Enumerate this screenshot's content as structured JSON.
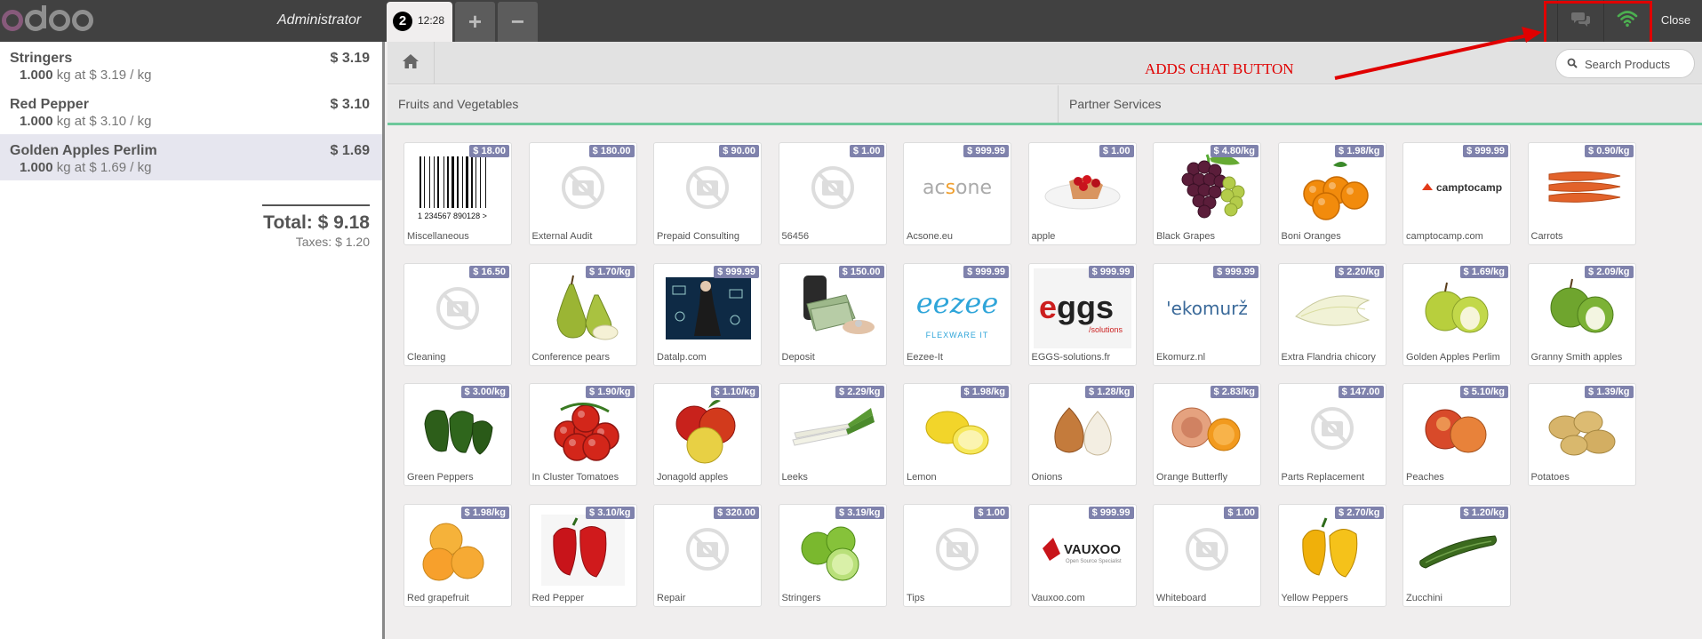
{
  "header": {
    "cashier": "Administrator",
    "order_number": "2",
    "order_time": "12:28",
    "add_order": "+",
    "delete_order": "−",
    "close_label": "Close",
    "icons": [
      "odoo-logo",
      "chat-icon",
      "wifi-icon"
    ],
    "colors": {
      "bar": "#414141",
      "wifi": "#4caf50",
      "highlight": "#e00000"
    }
  },
  "order": {
    "lines": [
      {
        "name": "Stringers",
        "price": "$ 3.19",
        "qty": "1.000",
        "info": "kg at $ 3.19 / kg"
      },
      {
        "name": "Red Pepper",
        "price": "$ 3.10",
        "qty": "1.000",
        "info": "kg at $ 3.10 / kg"
      },
      {
        "name": "Golden Apples Perlim",
        "price": "$ 1.69",
        "qty": "1.000",
        "info": "kg at $ 1.69 / kg"
      }
    ],
    "total": "Total: $ 9.18",
    "taxes": "Taxes: $ 1.20"
  },
  "search": {
    "placeholder": "Search Products"
  },
  "annotation": "ADDS CHAT BUTTON",
  "categories": [
    "Fruits and Vegetables",
    "Partner Services"
  ],
  "products": [
    {
      "name": "Miscellaneous",
      "price": "$ 18.00",
      "img": "barcode"
    },
    {
      "name": "External Audit",
      "price": "$ 180.00",
      "img": "noimage"
    },
    {
      "name": "Prepaid Consulting",
      "price": "$ 90.00",
      "img": "noimage"
    },
    {
      "name": "56456",
      "price": "$ 1.00",
      "img": "noimage"
    },
    {
      "name": "Acsone.eu",
      "price": "$ 999.99",
      "img": "logo-acsone"
    },
    {
      "name": "apple",
      "price": "$ 1.00",
      "img": "tart"
    },
    {
      "name": "Black Grapes",
      "price": "$ 4.80/kg",
      "img": "grapes"
    },
    {
      "name": "Boni Oranges",
      "price": "$ 1.98/kg",
      "img": "oranges"
    },
    {
      "name": "camptocamp.com",
      "price": "$ 999.99",
      "img": "logo-camptocamp"
    },
    {
      "name": "Carrots",
      "price": "$ 0.90/kg",
      "img": "carrots"
    },
    {
      "name": "Cleaning",
      "price": "$ 16.50",
      "img": "noimage"
    },
    {
      "name": "Conference pears",
      "price": "$ 1.70/kg",
      "img": "pears"
    },
    {
      "name": "Datalp.com",
      "price": "$ 999.99",
      "img": "datalp"
    },
    {
      "name": "Deposit",
      "price": "$ 150.00",
      "img": "money"
    },
    {
      "name": "Eezee-It",
      "price": "$ 999.99",
      "img": "logo-eezee"
    },
    {
      "name": "EGGS-solutions.fr",
      "price": "$ 999.99",
      "img": "logo-eggs"
    },
    {
      "name": "Ekomurz.nl",
      "price": "$ 999.99",
      "img": "logo-ekomurz"
    },
    {
      "name": "Extra Flandria chicory",
      "price": "$ 2.20/kg",
      "img": "chicory"
    },
    {
      "name": "Golden Apples Perlim",
      "price": "$ 1.69/kg",
      "img": "golden-apples"
    },
    {
      "name": "Granny Smith apples",
      "price": "$ 2.09/kg",
      "img": "granny-apples"
    },
    {
      "name": "Green Peppers",
      "price": "$ 3.00/kg",
      "img": "green-peppers"
    },
    {
      "name": "In Cluster Tomatoes",
      "price": "$ 1.90/kg",
      "img": "tomatoes"
    },
    {
      "name": "Jonagold apples",
      "price": "$ 1.10/kg",
      "img": "jonagold"
    },
    {
      "name": "Leeks",
      "price": "$ 2.29/kg",
      "img": "leeks"
    },
    {
      "name": "Lemon",
      "price": "$ 1.98/kg",
      "img": "lemon"
    },
    {
      "name": "Onions",
      "price": "$ 1.28/kg",
      "img": "onions"
    },
    {
      "name": "Orange Butterfly",
      "price": "$ 2.83/kg",
      "img": "orange-butterfly"
    },
    {
      "name": "Parts Replacement",
      "price": "$ 147.00",
      "img": "noimage"
    },
    {
      "name": "Peaches",
      "price": "$ 5.10/kg",
      "img": "peaches"
    },
    {
      "name": "Potatoes",
      "price": "$ 1.39/kg",
      "img": "potatoes"
    },
    {
      "name": "Red grapefruit",
      "price": "$ 1.98/kg",
      "img": "grapefruit"
    },
    {
      "name": "Red Pepper",
      "price": "$ 3.10/kg",
      "img": "red-pepper"
    },
    {
      "name": "Repair",
      "price": "$ 320.00",
      "img": "noimage"
    },
    {
      "name": "Stringers",
      "price": "$ 3.19/kg",
      "img": "limes"
    },
    {
      "name": "Tips",
      "price": "$ 1.00",
      "img": "noimage"
    },
    {
      "name": "Vauxoo.com",
      "price": "$ 999.99",
      "img": "logo-vauxoo"
    },
    {
      "name": "Whiteboard",
      "price": "$ 1.00",
      "img": "noimage"
    },
    {
      "name": "Yellow Peppers",
      "price": "$ 2.70/kg",
      "img": "yellow-peppers"
    },
    {
      "name": "Zucchini",
      "price": "$ 1.20/kg",
      "img": "zucchini"
    }
  ],
  "logo_text": {
    "acsone": "acsone",
    "camptocamp": "camptocamp",
    "eezee": "eezee",
    "eezee_sub": "FLEXWARE IT",
    "eggs": "eggs",
    "eggs_sub": "/solutions",
    "ekomurz": "'ekomurž",
    "vauxoo": "VAUXOO",
    "vauxoo_sub": "Open Source Specialist",
    "barcode_digits": "1 234567 890128 >"
  }
}
